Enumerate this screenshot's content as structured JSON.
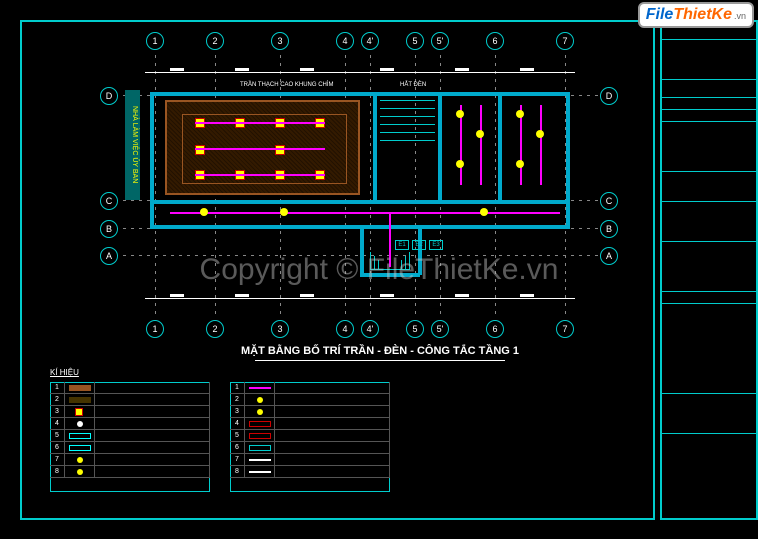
{
  "logo": {
    "part1": "File",
    "part2": "ThietKe",
    "suffix": ".vn"
  },
  "watermark": "Copyright © FileThietKe.vn",
  "drawing": {
    "title": "MẶT BẰNG BỐ TRÍ TRẦN - ĐÈN - CÔNG TẮC TẦNG 1",
    "grid_h": [
      "1",
      "2",
      "3",
      "4",
      "4'",
      "5",
      "5'",
      "6",
      "7"
    ],
    "grid_v": [
      "A",
      "B",
      "C",
      "D"
    ],
    "notes": {
      "n1": "TRẦN THẠCH CAO KHUNG CHÌM",
      "n2": "HẮT ĐÈN",
      "sign": "NHÀ LÀM VIỆC ỦY BAN"
    },
    "panels": [
      "E1",
      "E2",
      "E3"
    ]
  },
  "legend": {
    "title": "KÍ HIỆU",
    "rows1": [
      {
        "i": "1",
        "desc": ""
      },
      {
        "i": "2",
        "desc": ""
      },
      {
        "i": "3",
        "desc": ""
      },
      {
        "i": "4",
        "desc": ""
      },
      {
        "i": "5",
        "desc": ""
      },
      {
        "i": "6",
        "desc": ""
      },
      {
        "i": "7",
        "desc": ""
      },
      {
        "i": "8",
        "desc": ""
      }
    ],
    "rows2": [
      {
        "i": "1",
        "desc": ""
      },
      {
        "i": "2",
        "desc": ""
      },
      {
        "i": "3",
        "desc": ""
      },
      {
        "i": "4",
        "desc": ""
      },
      {
        "i": "5",
        "desc": ""
      },
      {
        "i": "6",
        "desc": ""
      },
      {
        "i": "7",
        "desc": ""
      },
      {
        "i": "8",
        "desc": ""
      }
    ]
  },
  "titleblock": {
    "r1": "",
    "r2": "",
    "r3": "",
    "r4": "",
    "r5": "",
    "r6": "",
    "r7": "",
    "r8": "",
    "r9": "",
    "r10": "",
    "r11": "",
    "r12": ""
  }
}
